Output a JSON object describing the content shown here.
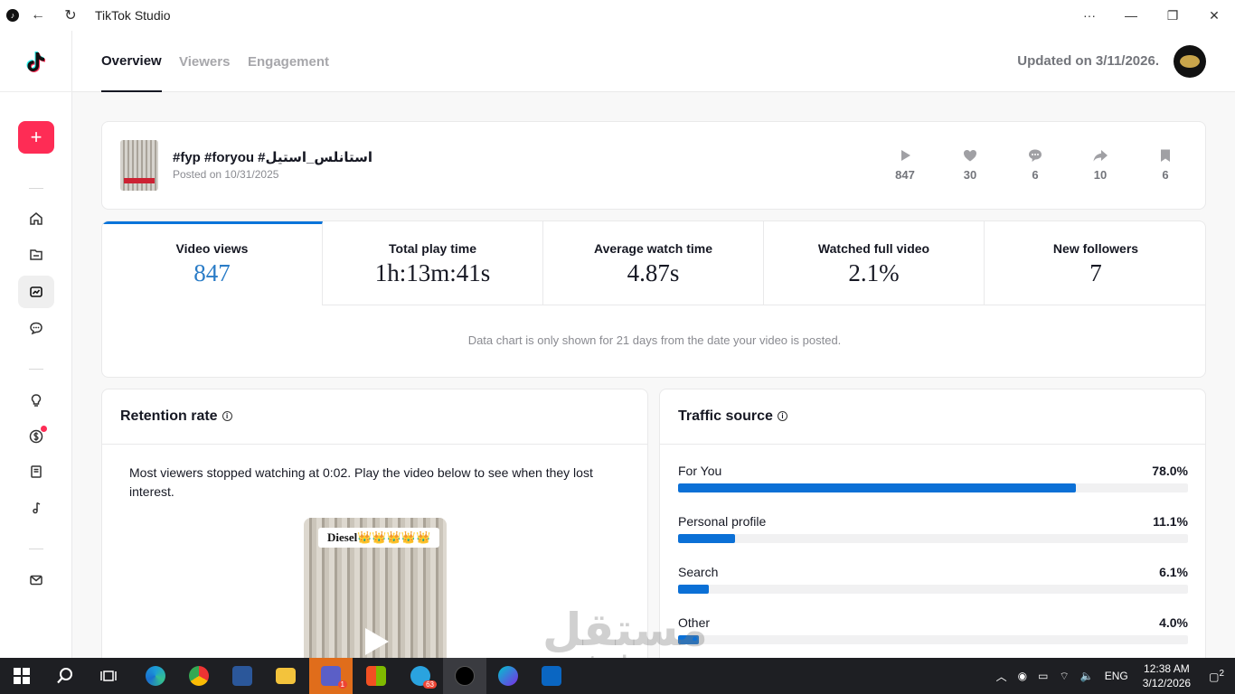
{
  "window": {
    "title": "TikTok Studio"
  },
  "header": {
    "tabs": [
      {
        "label": "Overview",
        "active": true
      },
      {
        "label": "Viewers",
        "active": false
      },
      {
        "label": "Engagement",
        "active": false
      }
    ],
    "updated": "Updated on 3/11/2026."
  },
  "sidebar": {
    "create_label": "+",
    "items": [
      "home-icon",
      "folder-icon",
      "analytics-icon",
      "comments-icon",
      "lightbulb-icon",
      "monetization-icon",
      "academy-icon",
      "sounds-icon",
      "feedback-icon"
    ]
  },
  "video": {
    "title": "#fyp #foryou #استانلس_استيل",
    "posted": "Posted on 10/31/2025",
    "stats": [
      {
        "icon": "play-icon",
        "value": "847"
      },
      {
        "icon": "heart-icon",
        "value": "30"
      },
      {
        "icon": "comment-icon",
        "value": "6"
      },
      {
        "icon": "share-icon",
        "value": "10"
      },
      {
        "icon": "bookmark-icon",
        "value": "6"
      }
    ]
  },
  "metrics": [
    {
      "label": "Video views",
      "value": "847",
      "active": true
    },
    {
      "label": "Total play time",
      "value": "1h:13m:41s",
      "active": false
    },
    {
      "label": "Average watch time",
      "value": "4.87s",
      "active": false
    },
    {
      "label": "Watched full video",
      "value": "2.1%",
      "active": false
    },
    {
      "label": "New followers",
      "value": "7",
      "active": false
    }
  ],
  "chart_note": "Data chart is only shown for 21 days from the date your video is posted.",
  "retention": {
    "title": "Retention rate",
    "text": "Most viewers stopped watching at 0:02. Play the video below to see when they lost interest.",
    "video_caption": "Diesel👑👑👑👑👑"
  },
  "traffic": {
    "title": "Traffic source",
    "sources": [
      {
        "name": "For You",
        "pct": "78.0%",
        "fraction": 0.78
      },
      {
        "name": "Personal profile",
        "pct": "11.1%",
        "fraction": 0.111
      },
      {
        "name": "Search",
        "pct": "6.1%",
        "fraction": 0.061
      },
      {
        "name": "Other",
        "pct": "4.0%",
        "fraction": 0.04
      }
    ]
  },
  "taskbar": {
    "lang": "ENG",
    "time": "12:38 AM",
    "date": "3/12/2026",
    "notifications": "2",
    "teams_badge": "1",
    "telegram_badge": "63"
  },
  "watermark": {
    "arabic": "مستقل",
    "latin": "mostaql.com"
  }
}
